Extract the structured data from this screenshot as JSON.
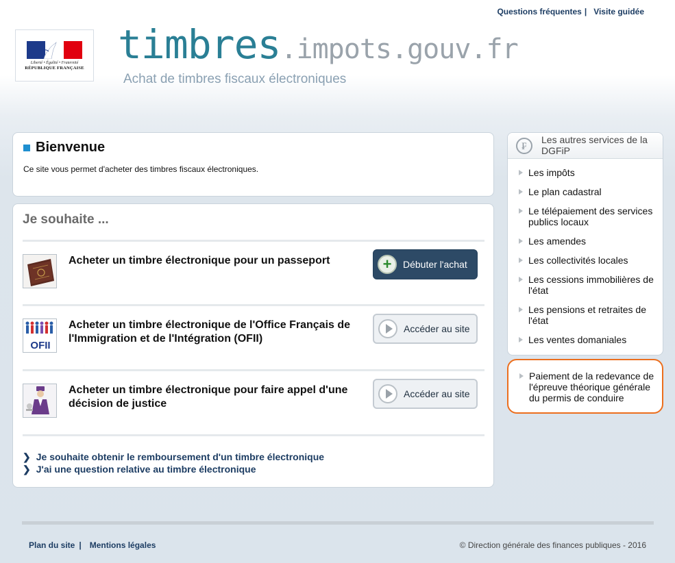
{
  "top_links": {
    "faq": "Questions fréquentes",
    "separator": "|",
    "guided_tour": "Visite guidée"
  },
  "logo": {
    "motto": "Liberté • Égalité • Fraternité",
    "republic": "RÉPUBLIQUE FRANÇAISE"
  },
  "brand": {
    "primary": "timbres",
    "secondary": ".impots.gouv.fr",
    "tagline": "Achat de timbres fiscaux électroniques"
  },
  "welcome": {
    "title": "Bienvenue",
    "text": "Ce site vous permet d'acheter des timbres fiscaux électroniques."
  },
  "wish": {
    "title": "Je souhaite ...",
    "offers": [
      {
        "title": "Acheter un timbre électronique pour un passeport",
        "button": "Débuter l'achat",
        "icon": "passport-icon",
        "style": "dark"
      },
      {
        "title": "Acheter un timbre électronique de l'Office Français de l'Immigration et de l'Intégration (OFII)",
        "button": "Accéder au site",
        "icon": "ofii-logo-icon",
        "style": "light",
        "icon_text": "OFII"
      },
      {
        "title": "Acheter un timbre électronique pour faire appel d'une décision de justice",
        "button": "Accéder au site",
        "icon": "justice-icon",
        "style": "light"
      }
    ],
    "links": [
      "Je souhaite obtenir le remboursement d'un timbre électronique",
      "J'ai une question relative au timbre électronique"
    ]
  },
  "services": {
    "title": "Les autres services de la DGFiP",
    "logo_glyph": "₣",
    "items": [
      "Les impôts",
      "Le plan cadastral",
      "Le télépaiement des services publics locaux",
      "Les amendes",
      "Les collectivités locales",
      "Les cessions immobilières de l'état",
      "Les pensions et retraites de l'état",
      "Les ventes domaniales"
    ]
  },
  "permis": {
    "label": "Paiement de la redevance de l'épreuve théorique générale du permis de conduire"
  },
  "footer": {
    "sitemap": "Plan du site",
    "separator": "|",
    "legal": "Mentions légales",
    "copyright": "© Direction générale des finances publiques - 2016"
  },
  "colors": {
    "brand_teal": "#2a7f95",
    "navy": "#1d3d63",
    "highlight_orange": "#ec6e1d",
    "dark_button": "#2d4a66"
  }
}
